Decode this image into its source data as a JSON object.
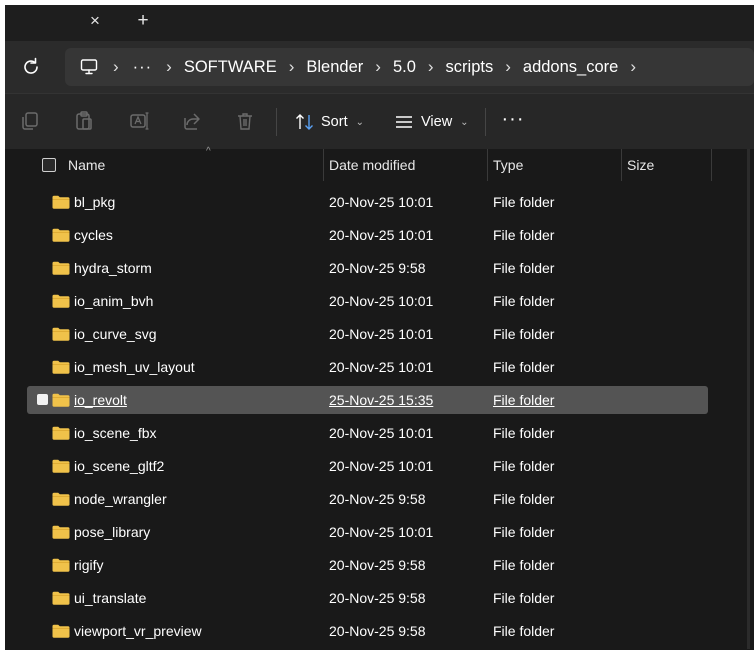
{
  "tabs": {
    "close_glyph": "×",
    "new_glyph": "+"
  },
  "address": {
    "breadcrumbs": [
      "SOFTWARE",
      "Blender",
      "5.0",
      "scripts",
      "addons_core"
    ],
    "overflow_label": "···",
    "separator": "›"
  },
  "toolbar": {
    "sort_label": "Sort",
    "view_label": "View",
    "more_label": "···"
  },
  "columns": {
    "name": "Name",
    "date": "Date modified",
    "type": "Type",
    "size": "Size"
  },
  "rows": [
    {
      "name": "bl_pkg",
      "date": "20-Nov-25 10:01",
      "type": "File folder",
      "selected": false
    },
    {
      "name": "cycles",
      "date": "20-Nov-25 10:01",
      "type": "File folder",
      "selected": false
    },
    {
      "name": "hydra_storm",
      "date": "20-Nov-25 9:58",
      "type": "File folder",
      "selected": false
    },
    {
      "name": "io_anim_bvh",
      "date": "20-Nov-25 10:01",
      "type": "File folder",
      "selected": false
    },
    {
      "name": "io_curve_svg",
      "date": "20-Nov-25 10:01",
      "type": "File folder",
      "selected": false
    },
    {
      "name": "io_mesh_uv_layout",
      "date": "20-Nov-25 10:01",
      "type": "File folder",
      "selected": false
    },
    {
      "name": "io_revolt",
      "date": "25-Nov-25 15:35",
      "type": "File folder",
      "selected": true
    },
    {
      "name": "io_scene_fbx",
      "date": "20-Nov-25 10:01",
      "type": "File folder",
      "selected": false
    },
    {
      "name": "io_scene_gltf2",
      "date": "20-Nov-25 10:01",
      "type": "File folder",
      "selected": false
    },
    {
      "name": "node_wrangler",
      "date": "20-Nov-25 9:58",
      "type": "File folder",
      "selected": false
    },
    {
      "name": "pose_library",
      "date": "20-Nov-25 10:01",
      "type": "File folder",
      "selected": false
    },
    {
      "name": "rigify",
      "date": "20-Nov-25 9:58",
      "type": "File folder",
      "selected": false
    },
    {
      "name": "ui_translate",
      "date": "20-Nov-25 9:58",
      "type": "File folder",
      "selected": false
    },
    {
      "name": "viewport_vr_preview",
      "date": "20-Nov-25 9:58",
      "type": "File folder",
      "selected": false
    }
  ],
  "colors": {
    "background": "#191919",
    "toolbar": "#272727",
    "address_bar": "#2b2b2b",
    "selection": "#545454",
    "folder": "#f0c24a"
  }
}
